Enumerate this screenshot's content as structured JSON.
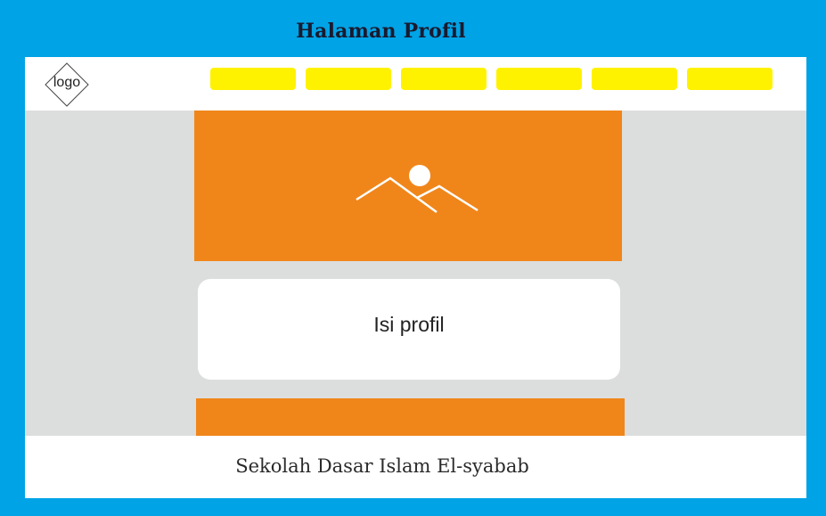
{
  "page_title": "Halaman Profil",
  "navbar": {
    "logo_label": "logo",
    "menu_items": [
      "",
      "",
      "",
      "",
      "",
      ""
    ]
  },
  "hero": {
    "icon": "image-placeholder-icon"
  },
  "content": {
    "text": "Isi profil"
  },
  "footer": {
    "text": "Sekolah Dasar Islam El-syabab"
  },
  "colors": {
    "frame": "#00a3e6",
    "background": "#dcdedd",
    "nav_item": "#fff200",
    "orange": "#f0861a",
    "card": "#ffffff"
  }
}
